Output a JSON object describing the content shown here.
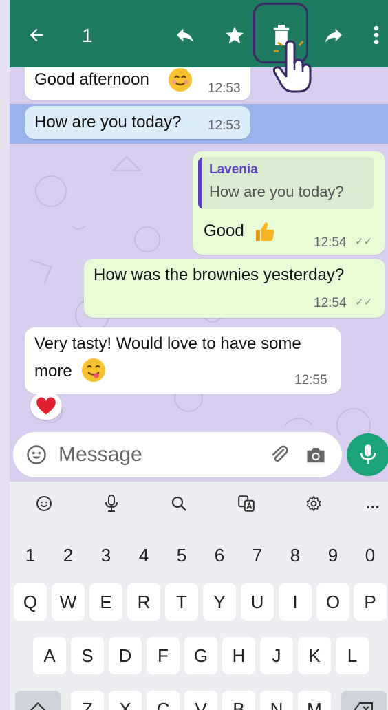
{
  "top_bar": {
    "selected_count": "1",
    "colors": {
      "bar": "#1f7a62",
      "highlight_border": "#3a2a66"
    }
  },
  "messages": [
    {
      "direction": "incoming",
      "text": "Good afternoon",
      "emoji": "smiling-face-emoji",
      "time": "12:53"
    },
    {
      "direction": "incoming",
      "text": "How are you today?",
      "time": "12:53",
      "selected": true
    },
    {
      "direction": "outgoing",
      "quote": {
        "author": "Lavenia",
        "text": "How are you today?"
      },
      "text": "Good",
      "emoji": "thumbs-up-emoji",
      "time": "12:54"
    },
    {
      "direction": "outgoing",
      "text": "How was the brownies yesterday?",
      "time": "12:54"
    },
    {
      "direction": "incoming",
      "text_line1": "Very tasty! Would love to have some",
      "text_line2": "more",
      "emoji": "yum-face-emoji",
      "time": "12:55",
      "reaction": "red-heart-emoji"
    }
  ],
  "compose": {
    "placeholder": "Message"
  },
  "keyboard": {
    "numbers": [
      "1",
      "2",
      "3",
      "4",
      "5",
      "6",
      "7",
      "8",
      "9",
      "0"
    ],
    "row_q": [
      "Q",
      "W",
      "E",
      "R",
      "T",
      "Y",
      "U",
      "I",
      "O",
      "P"
    ],
    "row_a": [
      "A",
      "S",
      "D",
      "F",
      "G",
      "H",
      "J",
      "K",
      "L"
    ],
    "row_z": [
      "Z",
      "X",
      "C",
      "V",
      "B",
      "N",
      "M"
    ],
    "more": "..."
  }
}
